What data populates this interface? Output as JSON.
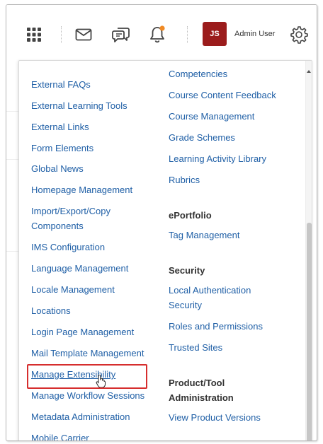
{
  "topbar": {
    "icons": [
      "apps-grid-icon",
      "mail-icon",
      "chat-icon",
      "bell-icon",
      "gear-icon"
    ],
    "avatar_initials": "JS",
    "username": "Admin User",
    "accent": "#9b1c1c",
    "notification_dot": "#f08a24"
  },
  "menu": {
    "left": [
      "External FAQs",
      "External Learning Tools",
      "External Links",
      "Form Elements",
      "Global News",
      "Homepage Management",
      "Import/Export/Copy",
      "Components",
      "IMS Configuration",
      "Language Management",
      "Locale Management",
      "Locations",
      "Login Page Management",
      "Mail Template Management",
      "Manage Extensibility",
      "Manage Workflow Sessions",
      "Metadata Administration",
      "Mobile Carrier"
    ],
    "right_top": [
      "Competencies",
      "Course Content Feedback",
      "Course Management",
      "Grade Schemes",
      "Learning Activity Library",
      "Rubrics"
    ],
    "eportfolio_heading": "ePortfolio",
    "eportfolio_items": [
      "Tag Management"
    ],
    "security_heading": "Security",
    "security_items": [
      "Local Authentication",
      "Security",
      "Roles and Permissions",
      "Trusted Sites"
    ],
    "product_heading": [
      "Product/Tool",
      "Administration"
    ],
    "product_items": [
      "View Product Versions"
    ],
    "link_color": "#1f5fa6",
    "highlight_color": "#d62e2e"
  }
}
